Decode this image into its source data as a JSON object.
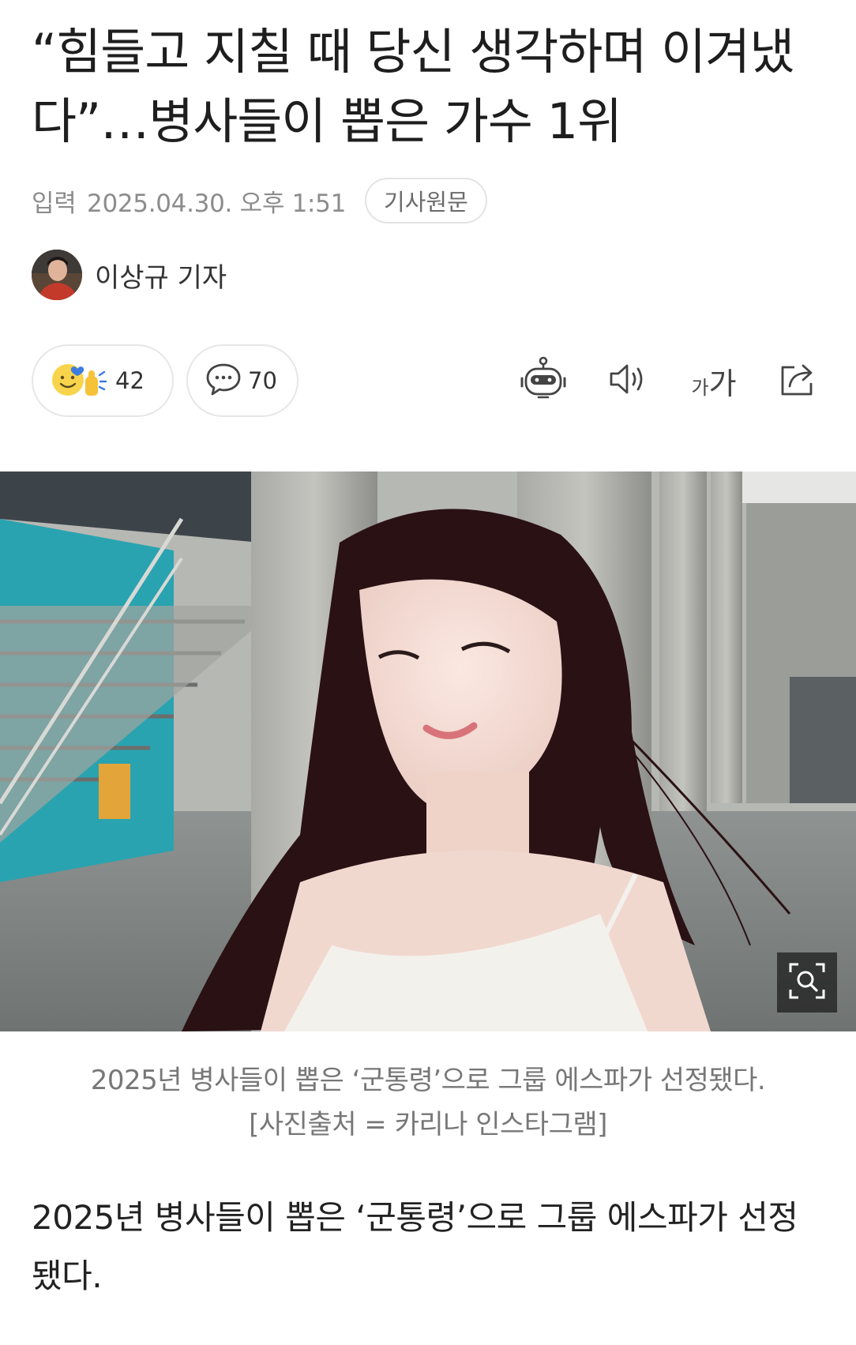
{
  "article": {
    "title": "“힘들고 지칠 때 당신 생각하며 이겨냈다”…병사들이 뽑은 가수 1위",
    "date_label": "입력",
    "date_value": "2025.04.30. 오후 1:51",
    "original_button": "기사원문",
    "author": "이상규 기자"
  },
  "actions": {
    "reaction_count": "42",
    "comment_count": "70",
    "font_small": "가",
    "font_large": "가"
  },
  "icons": {
    "reaction": "smile-thumbs-icon",
    "comment": "speech-bubble-icon",
    "summary": "robot-icon",
    "tts": "speaker-icon",
    "font": "font-size-icon",
    "share": "share-icon",
    "zoom": "magnifier-icon"
  },
  "photo": {
    "caption_line1": "2025년 병사들이 뽑은 ‘군통령’으로 그룹 에스파가 선정됐다.",
    "caption_line2": "[사진출처 = 카리나 인스타그램]"
  },
  "body": {
    "paragraph1": "2025년 병사들이 뽑은 ‘군통령’으로 그룹 에스파가 선정됐다."
  },
  "colors": {
    "meta_text": "#8c8c8c",
    "border": "#e3e3e3",
    "wall_teal": "#2aa3b0"
  }
}
